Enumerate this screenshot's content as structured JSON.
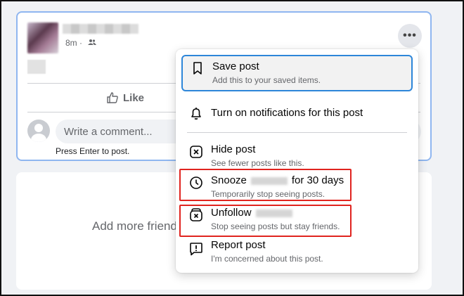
{
  "post": {
    "time": "8m ·",
    "more_label": "•••",
    "like_label": "Like",
    "comment_placeholder": "Write a comment...",
    "hint": "Press Enter to post."
  },
  "second_card": {
    "text": "Add more friend"
  },
  "menu": {
    "items": [
      {
        "title": "Save post",
        "sub": "Add this to your saved items.",
        "icon": "bookmark-icon"
      },
      {
        "title": "Turn on notifications for this post",
        "sub": "",
        "icon": "bell-icon"
      },
      {
        "title": "Hide post",
        "sub": "See fewer posts like this.",
        "icon": "close-square-icon"
      },
      {
        "title_prefix": "Snooze",
        "title_suffix": "for 30 days",
        "sub": "Temporarily stop seeing posts.",
        "icon": "clock-icon"
      },
      {
        "title_prefix": "Unfollow",
        "title_suffix": "",
        "sub": "Stop seeing posts but stay friends.",
        "icon": "unfollow-icon"
      },
      {
        "title": "Report post",
        "sub": "I'm concerned about this post.",
        "icon": "report-icon"
      }
    ]
  },
  "colors": {
    "highlight_border": "#e0241f",
    "focus_border": "#2d86d9"
  }
}
